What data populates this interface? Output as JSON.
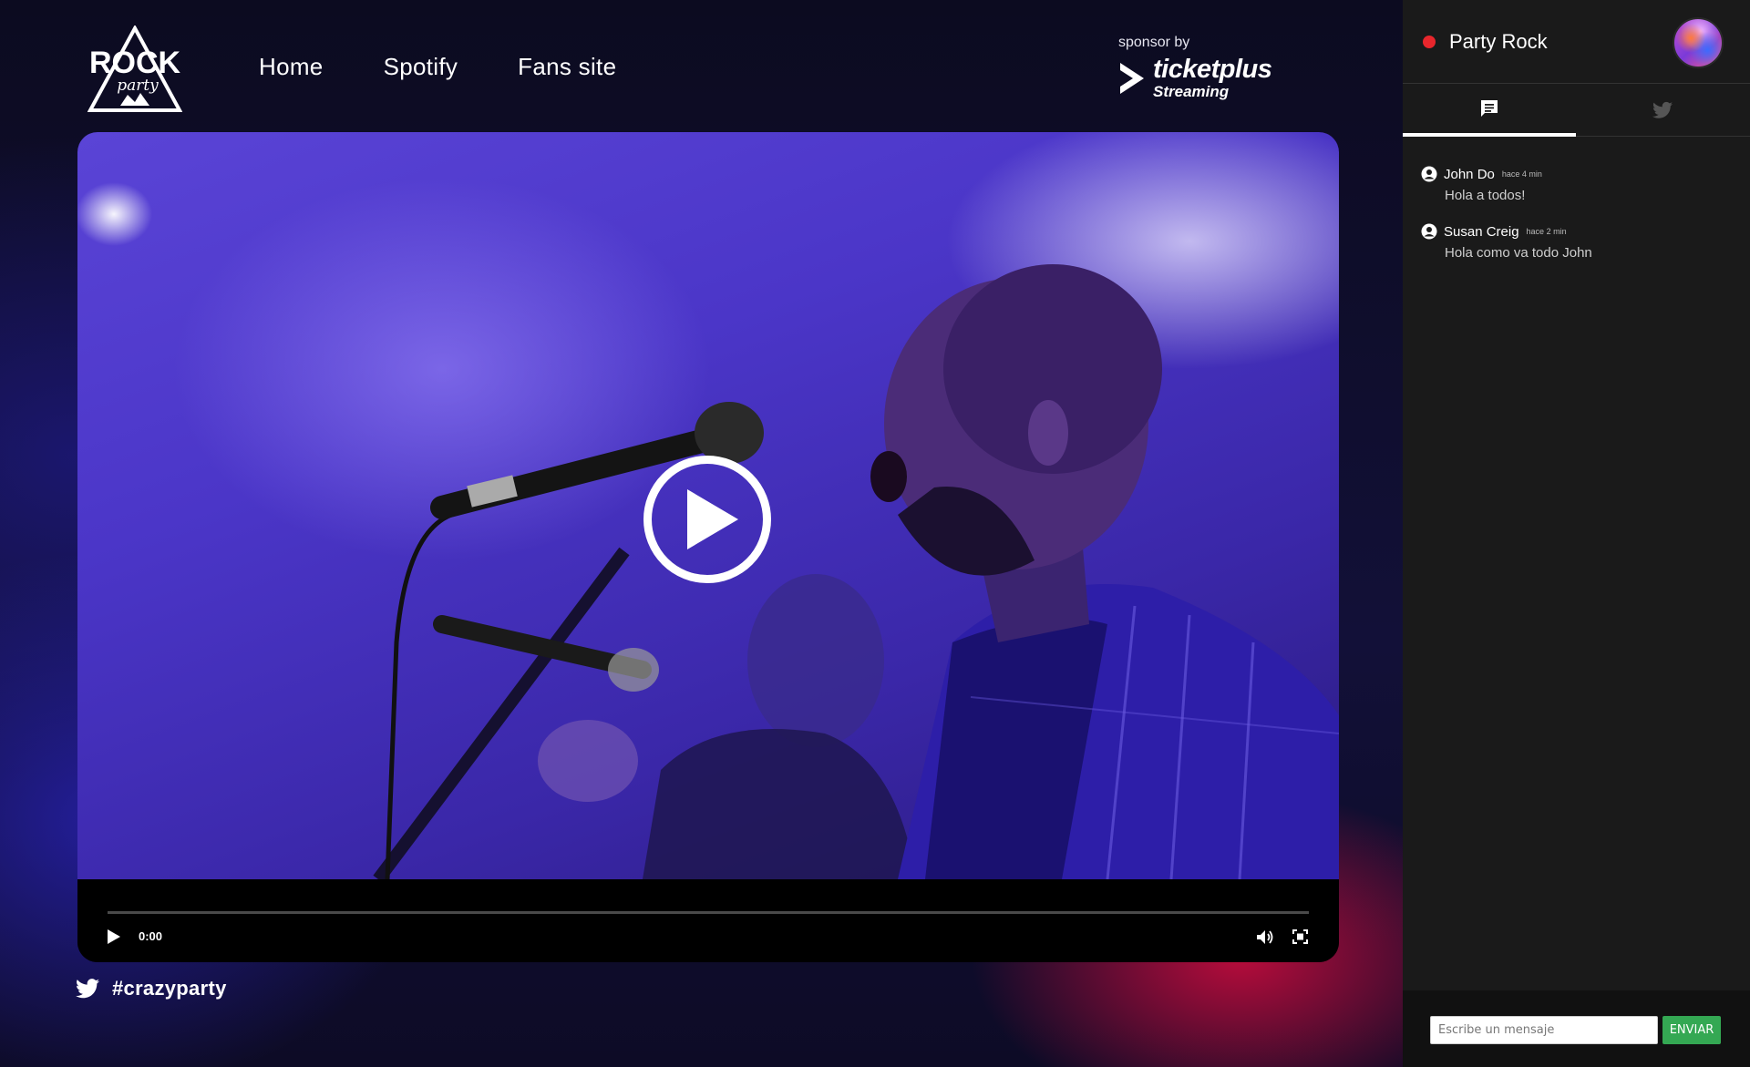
{
  "header": {
    "logo": {
      "line1": "ROCK",
      "line2": "party"
    },
    "nav": [
      {
        "label": "Home"
      },
      {
        "label": "Spotify"
      },
      {
        "label": "Fans site"
      }
    ],
    "sponsor": {
      "label": "sponsor by",
      "brand": "ticketplus",
      "sub": "Streaming"
    }
  },
  "player": {
    "time": "0:00",
    "progress": 0
  },
  "hashtag": "#crazyparty",
  "sidebar": {
    "title": "Party Rock",
    "live_color": "#e8262c",
    "tabs": [
      {
        "icon": "chat-icon",
        "active": true
      },
      {
        "icon": "twitter-icon",
        "active": false
      }
    ],
    "messages": [
      {
        "user": "John Do",
        "time": "hace 4 min",
        "text": "Hola a todos!"
      },
      {
        "user": "Susan Creig",
        "time": "hace 2 min",
        "text": "Hola como va todo John"
      }
    ],
    "input_placeholder": "Escribe un mensaje",
    "send_label": "ENVIAR",
    "send_color": "#34a853"
  }
}
